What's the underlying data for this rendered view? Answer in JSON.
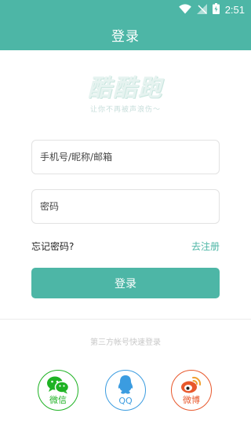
{
  "status_bar": {
    "time": "2:51",
    "icons": [
      "wifi-icon",
      "no-signal-icon",
      "battery-icon"
    ]
  },
  "app_bar": {
    "title": "登录"
  },
  "logo": {
    "text": "酷酷跑",
    "slogan": "让你不再被声浪伤～"
  },
  "form": {
    "username_placeholder": "手机号/昵称/邮箱",
    "password_placeholder": "密码",
    "forgot_label": "忘记密码?",
    "register_label": "去注册",
    "login_label": "登录"
  },
  "third_party": {
    "label": "第三方帐号快速登录",
    "providers": [
      {
        "id": "wechat",
        "label": "微信",
        "color": "#1eb223",
        "icon": "wechat-icon"
      },
      {
        "id": "qq",
        "label": "QQ",
        "color": "#3b9ce0",
        "icon": "qq-penguin-icon"
      },
      {
        "id": "weibo",
        "label": "微博",
        "color": "#e8582c",
        "icon": "weibo-icon"
      }
    ]
  },
  "colors": {
    "primary": "#4db6a6",
    "background": "#ffffff"
  }
}
